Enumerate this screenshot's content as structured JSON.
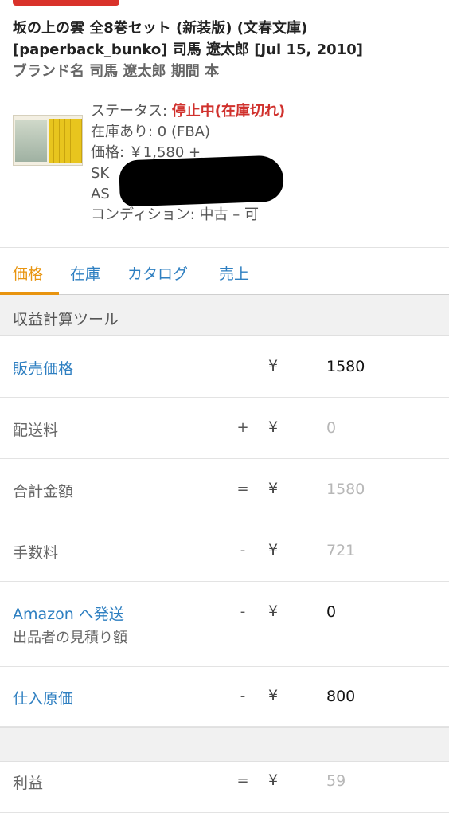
{
  "product": {
    "title": "坂の上の雲 全8巻セット (新装版) (文春文庫) [paperback_bunko] 司馬 遼太郎 [Jul 15, 2010]",
    "brand_line": "ブランド名 司馬 遼太郎 期間 本"
  },
  "info": {
    "status_label": "ステータス: ",
    "status_value": "停止中(在庫切れ)",
    "stock": "在庫あり: 0 (FBA)",
    "price": "価格: ￥1,580 +",
    "sku_prefix": "SK",
    "asin_prefix": "AS",
    "condition": "コンディション: 中古 – 可"
  },
  "tabs": [
    {
      "label": "価格"
    },
    {
      "label": "在庫"
    },
    {
      "label": "カタログ"
    },
    {
      "label": "売上"
    }
  ],
  "section_title": "収益計算ツール",
  "rows": [
    {
      "label": "販売価格",
      "op": "",
      "currency": "¥",
      "value": "1580"
    },
    {
      "label": "配送料",
      "op": "+",
      "currency": "¥",
      "value": "0"
    },
    {
      "label": "合計金額",
      "op": "=",
      "currency": "¥",
      "value": "1580"
    },
    {
      "label": "手数料",
      "op": "-",
      "currency": "¥",
      "value": "721"
    },
    {
      "label": "Amazon へ発送",
      "sublabel": "出品者の見積り額",
      "op": "-",
      "currency": "¥",
      "value": "0"
    },
    {
      "label": "仕入原価",
      "op": "-",
      "currency": "¥",
      "value": "800"
    },
    {
      "label": "利益",
      "op": "=",
      "currency": "¥",
      "value": "59"
    }
  ],
  "colors": {
    "link": "#2e7fc1",
    "active_tab": "#e8940f",
    "status_red": "#d0312d"
  }
}
